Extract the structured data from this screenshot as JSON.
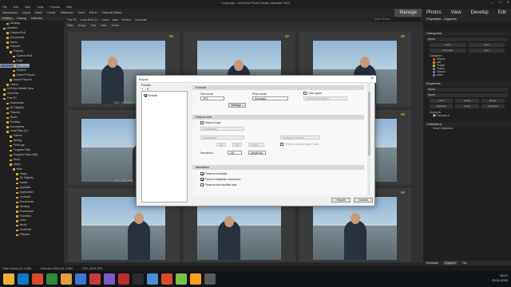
{
  "window": {
    "title": "Corporate - ACDSee Photo Studio Ultimate 2019",
    "controls": [
      "—",
      "☐",
      "✕"
    ]
  },
  "menu": [
    "File",
    "Edit",
    "View",
    "Tools",
    "Process",
    "Help"
  ],
  "toolbar": {
    "items": [
      "Workspaces",
      "Import",
      "Batch",
      "Create",
      "Slideshow",
      "Send",
      "Edit in",
      "External Editors"
    ],
    "modes": [
      "Manage",
      "Photos",
      "View",
      "Develop",
      "Edit"
    ]
  },
  "left_panel": {
    "tabs": [
      "Folders",
      "Catalog",
      "Calendar"
    ],
    "tree": [
      "Desktop",
      "Libraries",
      "Camera Roll",
      "Documents",
      "Music",
      "Pictures",
      "Pictures",
      "Camera Roll",
      "Corp",
      "Corporate",
      "Family",
      "Flowers",
      "Saved Pictures",
      "Saved Pictures",
      "Videos",
      "ACDSee Mobile Sync",
      "OneDrive",
      "This PC",
      "Downloads",
      "3D Objects",
      "Pictures",
      "Music",
      "Desktop",
      "Documents",
      "Local Disk (C:)",
      "Games",
      "Mining",
      "PerfLogs",
      "Program Files",
      "Program Files (x86)",
      "Temp",
      "Users",
      "alisa",
      "Origin",
      "3D Objects",
      "Adobe",
      "AppData",
      "Application",
      "Contacts",
      "Documents",
      "Desktop",
      "Downloads",
      "Favorites",
      "Links",
      "Music",
      "OneDrive",
      "Pictures"
    ],
    "selected_index": 9
  },
  "breadcrumb": [
    "This PC",
    "Local Disk (C:)",
    "Users",
    "alisa",
    "Pictures",
    "Corporate"
  ],
  "quick_search": "Quick Search",
  "filterbar": [
    "Filter",
    "Group",
    "Sort",
    "View",
    "Select"
  ],
  "thumbnails": [
    {
      "caption": "DSC_0076.JPG",
      "badge": "JPG"
    },
    {
      "caption": "",
      "badge": "JPG"
    },
    {
      "caption": "",
      "badge": "JPG"
    },
    {
      "caption": "IMG_0011.JPG",
      "badge": "JPG"
    },
    {
      "caption": "",
      "badge": "JPG"
    },
    {
      "caption": "",
      "badge": "JPG"
    },
    {
      "caption": "",
      "badge": "JPG"
    },
    {
      "caption": "",
      "badge": "JPG"
    },
    {
      "caption": "",
      "badge": "JPG"
    }
  ],
  "dialog": {
    "title": "Export",
    "presets_label": "Presets",
    "preset_tools": [
      "+",
      "✕"
    ],
    "preset_default": "Default",
    "sections": {
      "format": "Format",
      "output_size": "Output size",
      "metadata": "Metadata"
    },
    "format": {
      "file_format_label": "File format:",
      "file_format_value": "JPG",
      "pixel_format_label": "Pixel format:",
      "pixel_format_value": "Automatic",
      "color_space_label": "Color space",
      "color_space_value": "sRGB IEC61966-2.1",
      "settings_button": "Settings..."
    },
    "output_size": {
      "resize_label": "Resize image",
      "units_value": "Centimeters",
      "dimensions_value": "Dimensions",
      "width_value": "300",
      "height_value": "200",
      "enlarge_value": "Enlarge or reduce",
      "pixels_value": "Pixels",
      "preserve_aspect": "Preserve original aspect ratio",
      "resolution_label": "Resolution:",
      "resolution_value": "240",
      "resolution_unit": "pixels/inch"
    },
    "metadata": {
      "preserve_metadata": "Preserve metadata",
      "preserve_db_info": "Preserve database information",
      "preserve_modified": "Preserve last modified date"
    },
    "export_button": "Export",
    "cancel_button": "Cancel"
  },
  "right_panel": {
    "title": "Properties - Organize",
    "categories_head": "Categories",
    "cat_field": "Nyzal",
    "chips1": [
      "event",
      "team"
    ],
    "chips2": [
      "corporate",
      "party"
    ],
    "categories_label": "Categories",
    "cat_items": [
      {
        "name": "Albums",
        "color": "#c84848"
      },
      {
        "name": "pad",
        "color": "#d1822b"
      },
      {
        "name": "People",
        "color": "#b6b63a"
      },
      {
        "name": "Places",
        "color": "#4e9a4e"
      },
      {
        "name": "Various",
        "color": "#4e7ab8"
      },
      {
        "name": "water",
        "color": "#8a5bb5"
      }
    ],
    "keywords_head": "Keywords",
    "kw_field": "Nyzal",
    "kw_field2": "Nyzal",
    "chips3": [
      "yacht",
      "sailing",
      "people"
    ],
    "chips4": [
      "yachtclub",
      "racing",
      "celebrate"
    ],
    "keywords_label": "Keywords",
    "keyword_company": "Company A",
    "collections_head": "Collections",
    "smart_collections": "Smart Collections",
    "bottom_tabs": [
      "Metadata",
      "Organize",
      "File"
    ]
  },
  "status": [
    "Total 9 items (21.9 MB)",
    "Selected 9 files (21.9 MB)",
    "DSC_0076.JPG"
  ],
  "taskbar": {
    "icon_colors": [
      "#f0b133",
      "#0f7ac6",
      "#d84b2a",
      "#2f8a3b",
      "#e0a13a",
      "#3b78d4",
      "#c33d3d",
      "#7a5ac7",
      "#bd2d2d",
      "#2c2c2c",
      "#4c8fd6",
      "#d84b2a",
      "#7cc242",
      "#ff9f1a",
      "#5a5a5a"
    ],
    "time": "15:27",
    "date": "23.01.2019"
  }
}
